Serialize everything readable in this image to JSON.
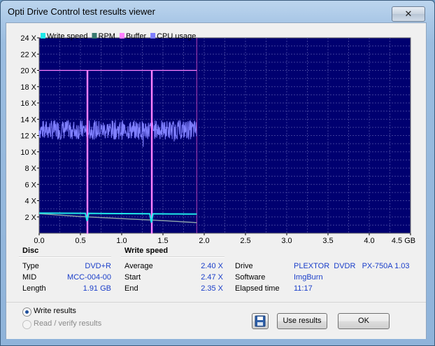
{
  "window": {
    "title": "Opti Drive Control test results viewer",
    "close_glyph": "✕"
  },
  "legend": [
    {
      "label": "Write speed",
      "color": "#1ee8e8"
    },
    {
      "label": "RPM",
      "color": "#3a7a70"
    },
    {
      "label": "Buffer",
      "color": "#ff80ff"
    },
    {
      "label": "CPU usage",
      "color": "#8080ff"
    }
  ],
  "chart_data": {
    "type": "line",
    "xlabel_unit": "GB",
    "x_ticks": [
      "0.0",
      "0.5",
      "1.0",
      "1.5",
      "2.0",
      "2.5",
      "3.0",
      "3.5",
      "4.0",
      "4.5 GB"
    ],
    "y_ticks": [
      "2 X",
      "4 X",
      "6 X",
      "8 X",
      "10 X",
      "12 X",
      "14 X",
      "16 X",
      "18 X",
      "20 X",
      "22 X",
      "24 X"
    ],
    "xlim": [
      0,
      4.5
    ],
    "ylim": [
      0,
      24
    ],
    "grid": true,
    "data_end_gb": 1.91,
    "series": [
      {
        "name": "Write speed",
        "x": [
          0.0,
          0.2,
          0.4,
          0.56,
          0.58,
          0.6,
          0.8,
          1.0,
          1.2,
          1.34,
          1.36,
          1.38,
          1.6,
          1.8,
          1.91
        ],
        "y": [
          2.47,
          2.46,
          2.45,
          2.44,
          1.5,
          2.44,
          2.42,
          2.41,
          2.4,
          2.39,
          1.3,
          2.39,
          2.37,
          2.36,
          2.35
        ]
      },
      {
        "name": "RPM",
        "x": [
          0.0,
          0.5,
          1.0,
          1.5,
          1.91
        ],
        "y": [
          2.4,
          2.05,
          1.8,
          1.55,
          1.3
        ]
      },
      {
        "name": "Buffer",
        "x": [
          0.0,
          0.58,
          0.58,
          0.59,
          0.59,
          1.36,
          1.36,
          1.37,
          1.37,
          1.91
        ],
        "y": [
          20,
          20,
          0,
          0,
          20,
          20,
          0,
          0,
          20,
          20
        ]
      },
      {
        "name": "CPU usage",
        "x_range": [
          0.0,
          1.91
        ],
        "mean": 12.7,
        "amplitude": 1.2
      }
    ]
  },
  "disc": {
    "title": "Disc",
    "rows": [
      {
        "label": "Type",
        "value": "DVD+R"
      },
      {
        "label": "MID",
        "value": "MCC-004-00"
      },
      {
        "label": "Length",
        "value": "1.91 GB"
      }
    ]
  },
  "write_speed": {
    "title": "Write speed",
    "rows": [
      {
        "label": "Average",
        "value": "2.40 X"
      },
      {
        "label": "Start",
        "value": "2.47 X"
      },
      {
        "label": "End",
        "value": "2.35 X"
      }
    ]
  },
  "drive_info": {
    "rows": [
      {
        "label": "Drive",
        "value": "PLEXTOR  DVDR   PX-750A 1.03"
      },
      {
        "label": "Software",
        "value": "ImgBurn"
      },
      {
        "label": "Elapsed time",
        "value": "11:17"
      }
    ]
  },
  "options": {
    "write_results": "Write results",
    "read_verify_results": "Read / verify results"
  },
  "buttons": {
    "use_results": "Use results",
    "ok": "OK"
  }
}
